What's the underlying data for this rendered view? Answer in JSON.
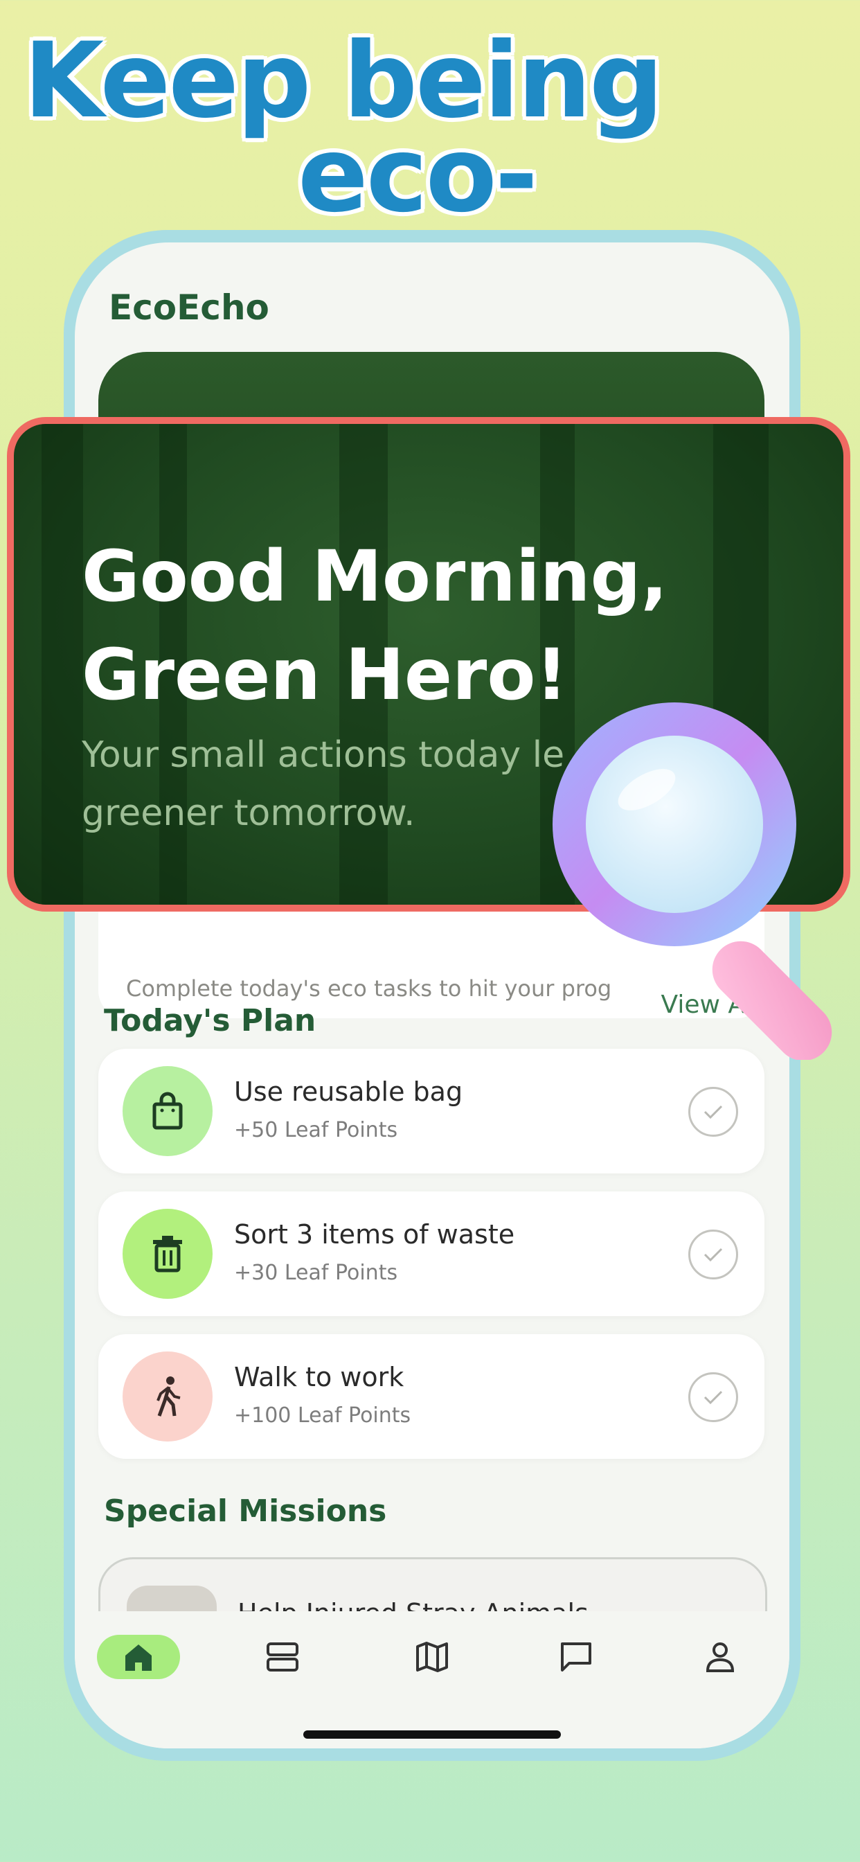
{
  "headline": {
    "line1": "Keep being",
    "line2": "eco-friendly"
  },
  "app": {
    "title": "EcoEcho"
  },
  "hero": {
    "greeting_line1": "Good Morning,",
    "greeting_line2": "Green Hero!",
    "subtitle": "Your small actions today le greener tomorrow."
  },
  "progress_card": {
    "text": "Complete today's eco tasks to hit your prog"
  },
  "todays_plan": {
    "title": "Today's Plan",
    "view_all": "View All",
    "items": [
      {
        "title": "Use reusable bag",
        "points": "+50 Leaf Points",
        "icon": "shopping-bag-icon",
        "icon_bg": "#b7f0a0"
      },
      {
        "title": "Sort 3 items of waste",
        "points": "+30 Leaf Points",
        "icon": "trash-icon",
        "icon_bg": "#b2f07d"
      },
      {
        "title": "Walk to work",
        "points": "+100 Leaf Points",
        "icon": "walking-person-icon",
        "icon_bg": "#fbd3cc"
      }
    ]
  },
  "special_missions": {
    "title": "Special Missions",
    "items": [
      {
        "title": "Help Injured Stray Animals"
      }
    ]
  },
  "tabbar": {
    "tabs": [
      {
        "name": "home",
        "icon": "home-icon",
        "active": true
      },
      {
        "name": "tasks",
        "icon": "stack-icon",
        "active": false
      },
      {
        "name": "map",
        "icon": "map-icon",
        "active": false
      },
      {
        "name": "chat",
        "icon": "chat-icon",
        "active": false
      },
      {
        "name": "profile",
        "icon": "profile-icon",
        "active": false
      }
    ]
  },
  "colors": {
    "accent": "#1f8ac5",
    "brand_green": "#245c36",
    "highlight_border": "#ef6a62",
    "active_tab": "#a8ec7e"
  }
}
